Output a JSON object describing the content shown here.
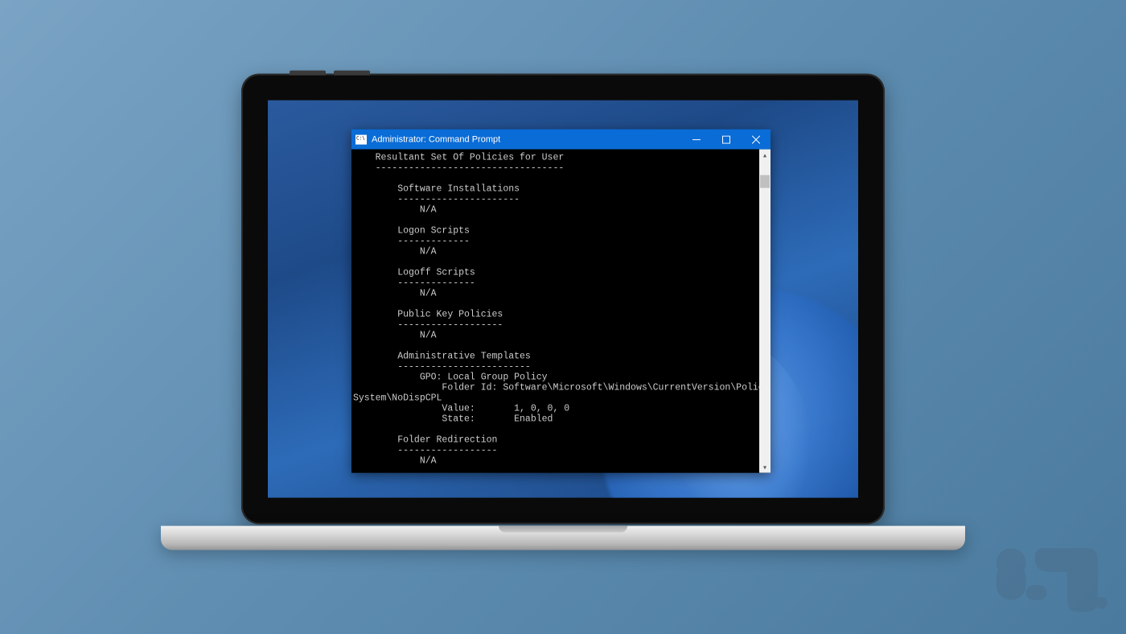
{
  "window": {
    "title": "Administrator: Command Prompt",
    "minimize_tooltip": "Minimize",
    "maximize_tooltip": "Maximize",
    "close_tooltip": "Close"
  },
  "terminal": {
    "lines": [
      "    Resultant Set Of Policies for User",
      "    ----------------------------------",
      "",
      "        Software Installations",
      "        ----------------------",
      "            N/A",
      "",
      "        Logon Scripts",
      "        -------------",
      "            N/A",
      "",
      "        Logoff Scripts",
      "        --------------",
      "            N/A",
      "",
      "        Public Key Policies",
      "        -------------------",
      "            N/A",
      "",
      "        Administrative Templates",
      "        ------------------------",
      "            GPO: Local Group Policy",
      "                Folder Id: Software\\Microsoft\\Windows\\CurrentVersion\\Policies\\",
      "System\\NoDispCPL",
      "                Value:       1, 0, 0, 0",
      "                State:       Enabled",
      "",
      "        Folder Redirection",
      "        ------------------",
      "            N/A"
    ]
  },
  "scrollbar": {
    "up_glyph": "▴",
    "down_glyph": "▾"
  }
}
